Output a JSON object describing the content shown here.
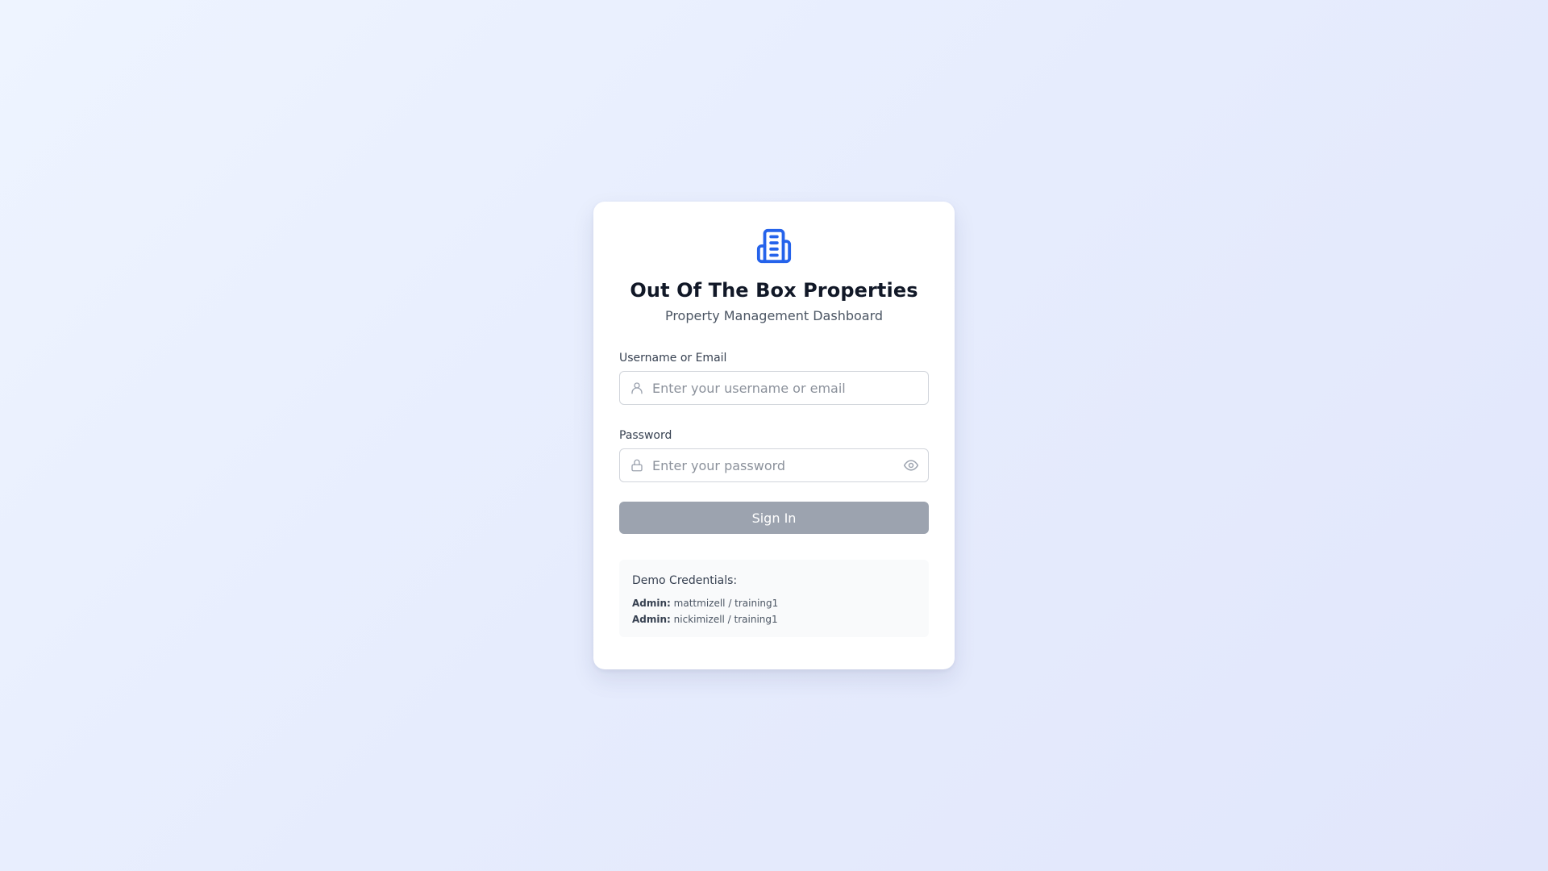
{
  "brand": {
    "icon": "building-icon",
    "accent_color": "#2563eb",
    "title": "Out Of The Box Properties",
    "subtitle": "Property Management Dashboard"
  },
  "form": {
    "username": {
      "label": "Username or Email",
      "placeholder": "Enter your username or email",
      "value": "",
      "icon": "user-icon"
    },
    "password": {
      "label": "Password",
      "placeholder": "Enter your password",
      "value": "",
      "icon": "lock-icon",
      "toggle_icon": "eye-icon"
    },
    "submit_label": "Sign In",
    "submit_color": "#9ca3af"
  },
  "demo": {
    "title": "Demo Credentials:",
    "accounts": [
      {
        "role": "Admin:",
        "credentials": "mattmizell / training1"
      },
      {
        "role": "Admin:",
        "credentials": "nickimizell / training1"
      }
    ]
  }
}
